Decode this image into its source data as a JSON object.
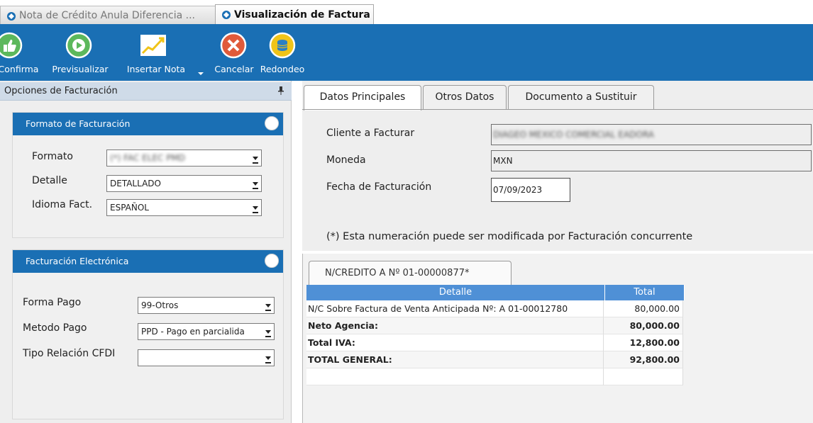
{
  "doc_tabs": [
    {
      "label": "Nota de Crédito Anula Diferencia ...",
      "active": false
    },
    {
      "label": "Visualización de Factura",
      "active": true
    }
  ],
  "toolbar": {
    "confirma": "Confirma",
    "previsualizar": "Previsualizar",
    "insertar_nota": "Insertar Nota",
    "cancelar": "Cancelar",
    "redondeo": "Redondeo"
  },
  "left": {
    "header": "Opciones de Facturación",
    "formato_group": {
      "title": "Formato de Facturación",
      "formato_label": "Formato",
      "formato_value": "(*) FAC ELEC PMD",
      "detalle_label": "Detalle",
      "detalle_value": "DETALLADO",
      "idioma_label": "Idioma Fact.",
      "idioma_value": "ESPAÑOL"
    },
    "electronica_group": {
      "title": "Facturación Electrónica",
      "forma_pago_label": "Forma Pago",
      "forma_pago_value": "99-Otros",
      "metodo_pago_label": "Metodo Pago",
      "metodo_pago_value": "PPD - Pago en parcialida",
      "tipo_relacion_label": "Tipo Relación CFDI",
      "tipo_relacion_value": ""
    }
  },
  "right": {
    "tabs": [
      "Datos Principales",
      "Otros Datos",
      "Documento a Sustituir"
    ],
    "cliente_label": "Cliente a Facturar",
    "cliente_value": "DIAGEO MEXICO COMERCIAL EADORA",
    "moneda_label": "Moneda",
    "moneda_value": "MXN",
    "fecha_label": "Fecha de Facturación",
    "fecha_value": "07/09/2023",
    "note": "(*) Esta numeración puede ser modificada por Facturación concurrente"
  },
  "credit": {
    "tab_label": "N/CREDITO A Nº 01-00000877*",
    "columns": [
      "Detalle",
      "Total"
    ],
    "rows": [
      {
        "detalle": "N/C Sobre Factura de Venta Anticipada Nº: A 01-00012780",
        "total": "80,000.00"
      },
      {
        "detalle": "Neto Agencia:",
        "total": "80,000.00"
      },
      {
        "detalle": "Total IVA:",
        "total": "12,800.00"
      },
      {
        "detalle": "TOTAL GENERAL:",
        "total": "92,800.00"
      },
      {
        "detalle": "",
        "total": ""
      }
    ]
  },
  "colors": {
    "toolbar_blue": "#1a6fb4",
    "grid_header": "#4f90d6",
    "panel_header": "#cfdbe8"
  }
}
